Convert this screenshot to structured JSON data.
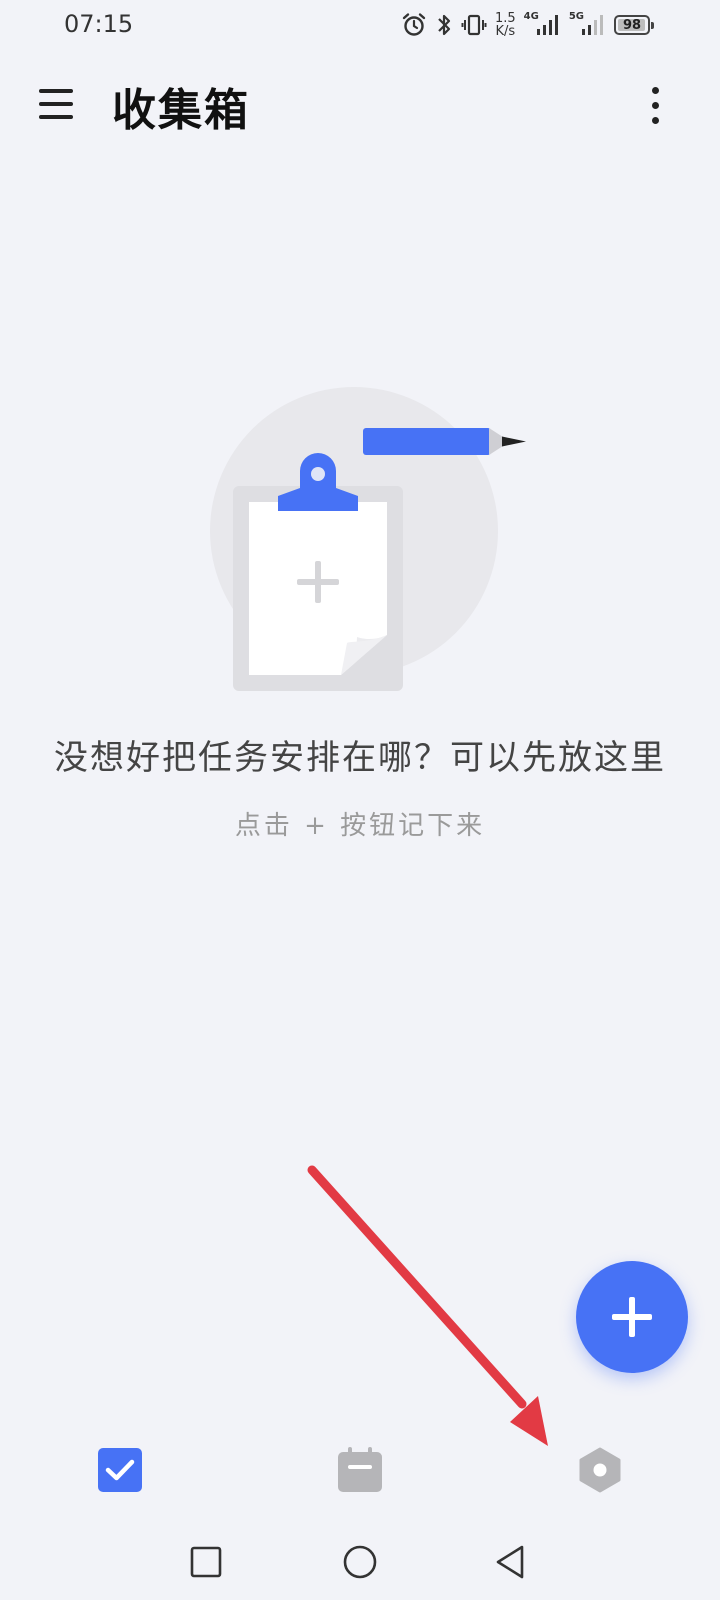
{
  "status_bar": {
    "time": "07:15",
    "net_speed_value": "1.5",
    "net_speed_unit": "K/s",
    "signal_1_label": "4G",
    "signal_2_label": "5G",
    "battery_level": "98",
    "battery_percent": 98,
    "icons": [
      "alarm-icon",
      "bluetooth-icon",
      "vibrate-icon",
      "signal-4g-icon",
      "signal-5g-icon",
      "battery-icon"
    ]
  },
  "app_bar": {
    "title": "收集箱",
    "menu_icon": "hamburger-menu-icon",
    "more_icon": "more-vertical-icon"
  },
  "empty_state": {
    "illustration": "clipboard-pencil-illustration",
    "title": "没想好把任务安排在哪？可以先放这里",
    "hint": "点击 + 按钮记下来"
  },
  "fab": {
    "icon": "plus-icon"
  },
  "bottom_nav": {
    "items": [
      {
        "icon": "checkbox-checked-icon",
        "active": true
      },
      {
        "icon": "calendar-icon",
        "active": false
      },
      {
        "icon": "settings-hexagon-icon",
        "active": false
      }
    ]
  },
  "system_nav": {
    "buttons": [
      "recent-apps-icon",
      "home-icon",
      "back-icon"
    ]
  },
  "colors": {
    "accent": "#4772f5",
    "background": "#f2f3f8",
    "annotation_arrow": "#e23a44",
    "inactive_icon": "#b5b5b8"
  }
}
